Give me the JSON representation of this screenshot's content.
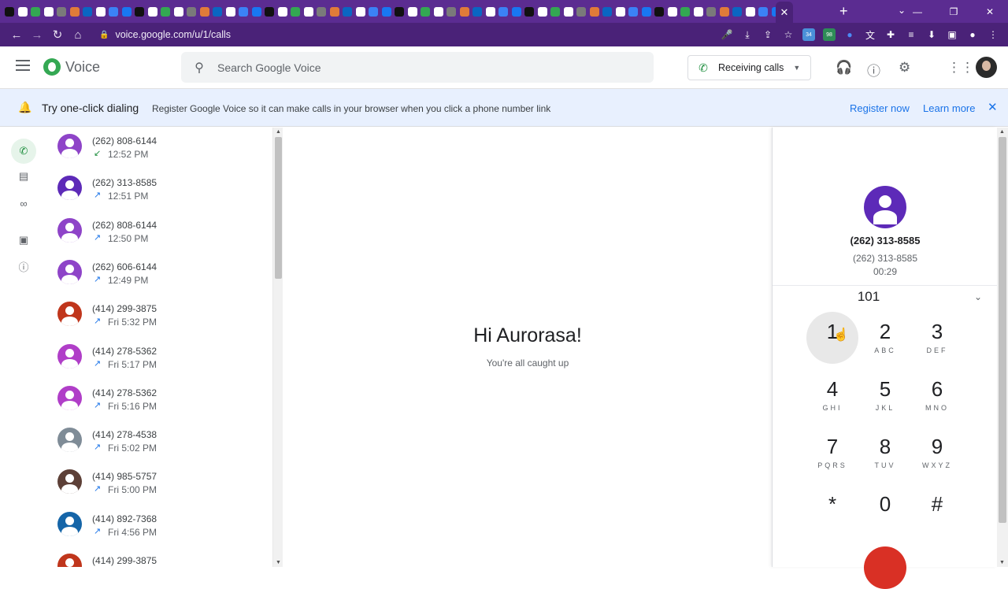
{
  "browser": {
    "url": "voice.google.com/u/1/calls",
    "tab_close": "✕",
    "new_tab": "+",
    "tab_search": "⌄",
    "window_controls": [
      "—",
      "❐",
      "✕"
    ],
    "nav": {
      "back": "←",
      "forward": "→",
      "reload": "↻",
      "home": "⌂"
    },
    "extension_badges": [
      "34",
      "98"
    ]
  },
  "header": {
    "app_name": "Voice",
    "search_placeholder": "Search Google Voice",
    "receiving_calls_label": "Receiving calls"
  },
  "banner": {
    "title": "Try one-click dialing",
    "description": "Register Google Voice so it can make calls in your browser when you click a phone number link",
    "register_label": "Register now",
    "learn_more_label": "Learn more"
  },
  "calls": [
    {
      "number": "(262) 808-6144",
      "time": "12:52 PM",
      "direction": "incoming",
      "color": "#8e44c8"
    },
    {
      "number": "(262) 313-8585",
      "time": "12:51 PM",
      "direction": "outgoing",
      "color": "#5d2ab8"
    },
    {
      "number": "(262) 808-6144",
      "time": "12:50 PM",
      "direction": "outgoing",
      "color": "#8e44c8"
    },
    {
      "number": "(262) 606-6144",
      "time": "12:49 PM",
      "direction": "outgoing",
      "color": "#8e44c8"
    },
    {
      "number": "(414) 299-3875",
      "time": "Fri 5:32 PM",
      "direction": "outgoing",
      "color": "#c0361c"
    },
    {
      "number": "(414) 278-5362",
      "time": "Fri 5:17 PM",
      "direction": "outgoing",
      "color": "#b03ec8"
    },
    {
      "number": "(414) 278-5362",
      "time": "Fri 5:16 PM",
      "direction": "outgoing",
      "color": "#b03ec8"
    },
    {
      "number": "(414) 278-4538",
      "time": "Fri 5:02 PM",
      "direction": "outgoing",
      "color": "#7f8c97"
    },
    {
      "number": "(414) 985-5757",
      "time": "Fri 5:00 PM",
      "direction": "outgoing",
      "color": "#5d4037"
    },
    {
      "number": "(414) 892-7368",
      "time": "Fri 4:56 PM",
      "direction": "outgoing",
      "color": "#1565a8"
    },
    {
      "number": "(414) 299-3875",
      "time": "",
      "direction": "outgoing",
      "color": "#c0361c"
    }
  ],
  "center": {
    "greeting": "Hi Aurorasa!",
    "status": "You're all caught up"
  },
  "dialer": {
    "contact_name": "(262) 313-8585",
    "contact_number": "(262) 313-8585",
    "timer": "00:29",
    "digits": "101",
    "keys": [
      {
        "digit": "1",
        "letters": ""
      },
      {
        "digit": "2",
        "letters": "ABC"
      },
      {
        "digit": "3",
        "letters": "DEF"
      },
      {
        "digit": "4",
        "letters": "GHI"
      },
      {
        "digit": "5",
        "letters": "JKL"
      },
      {
        "digit": "6",
        "letters": "MNO"
      },
      {
        "digit": "7",
        "letters": "PQRS"
      },
      {
        "digit": "8",
        "letters": "TUV"
      },
      {
        "digit": "9",
        "letters": "WXYZ"
      },
      {
        "digit": "*",
        "letters": ""
      },
      {
        "digit": "0",
        "letters": ""
      },
      {
        "digit": "#",
        "letters": ""
      }
    ],
    "pressed_key": "1"
  },
  "colors": {
    "brand_purple": "#5b2c91",
    "accent_blue": "#1a73e8",
    "voice_green": "#34a853",
    "end_call_red": "#d93025"
  }
}
